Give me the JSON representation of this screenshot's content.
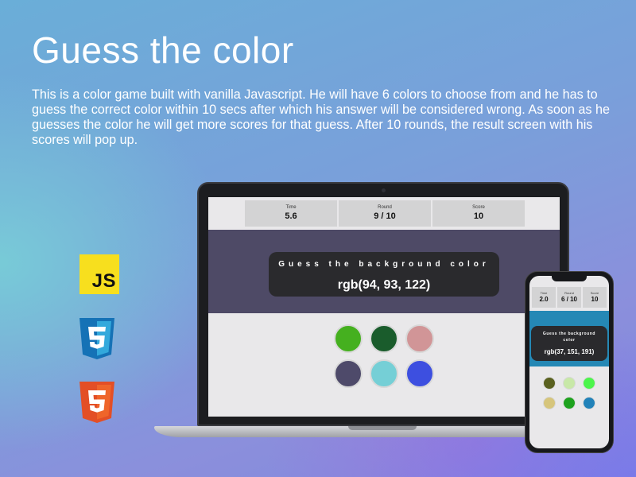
{
  "hero": {
    "title": "Guess the color",
    "description": "This is a color game built with vanilla Javascript. He will have 6 colors to choose from and he has to guess the correct color within 10 secs after which his answer will be considered wrong. As soon as he guesses the color he will get more scores for that guess. After 10 rounds, the result screen with his scores will pop up."
  },
  "tech": {
    "js_label": "JS",
    "js_color": "#f7df1e",
    "css_color": "#2965f1",
    "html_color": "#e44d26"
  },
  "laptop_game": {
    "stats": [
      {
        "label": "Time",
        "value": "5.6"
      },
      {
        "label": "Round",
        "value": "9 / 10"
      },
      {
        "label": "Score",
        "value": "10"
      }
    ],
    "question_title": "Guess the background color",
    "target_rgb": "rgb(94, 93, 122)",
    "band_color": "#4e4a66",
    "swatches": [
      "#45b01f",
      "#1a5c2c",
      "#d19597",
      "#4e4a6a",
      "#75cfd6",
      "#3d4fe0"
    ]
  },
  "phone_game": {
    "stats": [
      {
        "label": "Time",
        "value": "2.0"
      },
      {
        "label": "Round",
        "value": "6 / 10"
      },
      {
        "label": "Score",
        "value": "10"
      }
    ],
    "question_title": "Guess the background color",
    "target_rgb": "rgb(37, 151, 191)",
    "band_color": "#2588b5",
    "swatches": [
      "#5a6120",
      "#c8e8a8",
      "#4cf54c",
      "#d6c57c",
      "#1ea21e",
      "#2282b9"
    ]
  }
}
